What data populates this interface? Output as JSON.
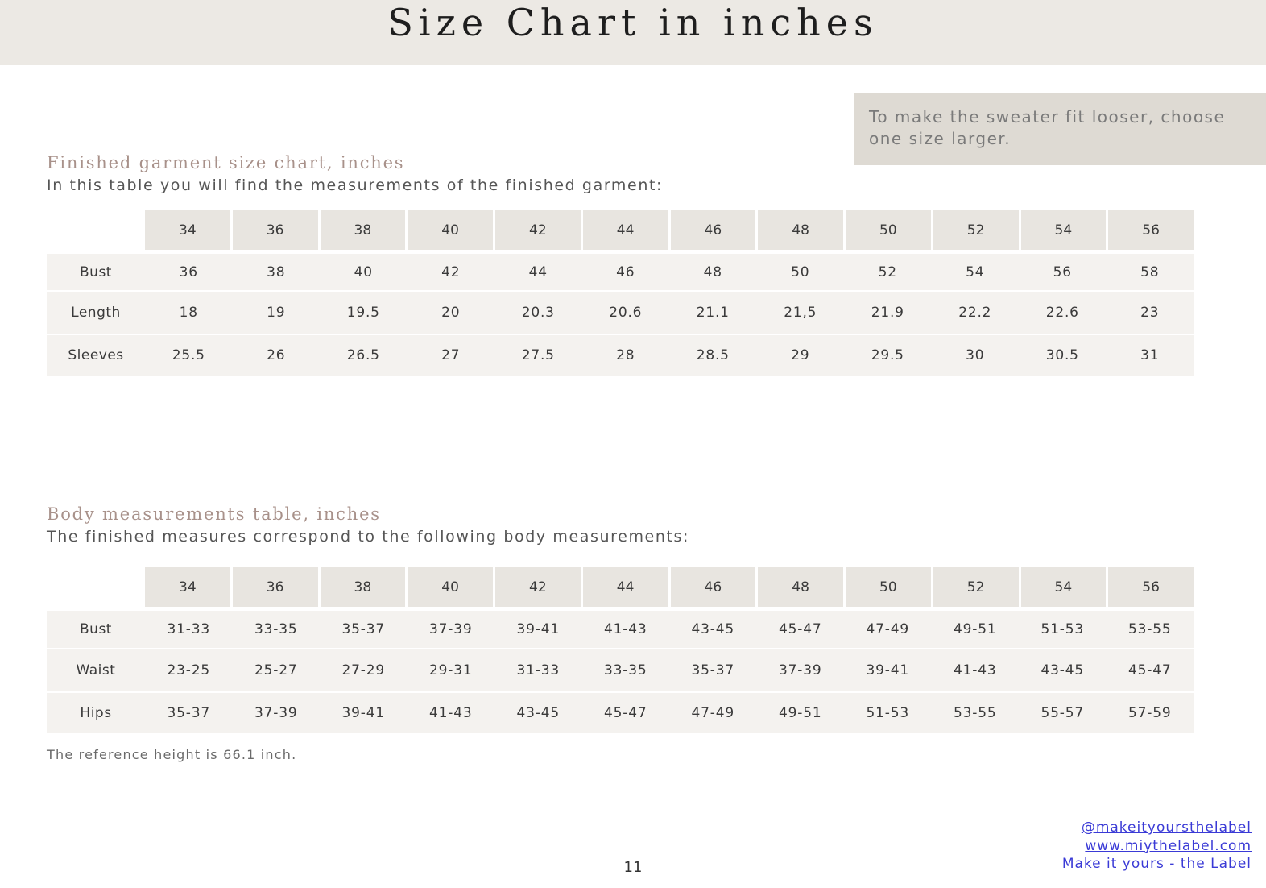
{
  "header": {
    "title": "Size Chart in inches"
  },
  "note": "To make the sweater fit looser, choose one size larger.",
  "finished_garment": {
    "title": "Finished garment size chart, inches",
    "subtitle": "In this table you will find the measurements of the finished garment:",
    "sizes": [
      "34",
      "36",
      "38",
      "40",
      "42",
      "44",
      "46",
      "48",
      "50",
      "52",
      "54",
      "56"
    ],
    "rows": [
      {
        "label": "Bust",
        "values": [
          "36",
          "38",
          "40",
          "42",
          "44",
          "46",
          "48",
          "50",
          "52",
          "54",
          "56",
          "58"
        ]
      },
      {
        "label": "Length",
        "values": [
          "18",
          "19",
          "19.5",
          "20",
          "20.3",
          "20.6",
          "21.1",
          "21,5",
          "21.9",
          "22.2",
          "22.6",
          "23"
        ]
      },
      {
        "label": "Sleeves",
        "values": [
          "25.5",
          "26",
          "26.5",
          "27",
          "27.5",
          "28",
          "28.5",
          "29",
          "29.5",
          "30",
          "30.5",
          "31"
        ]
      }
    ]
  },
  "body_measurements": {
    "title": "Body measurements table, inches",
    "subtitle": "The finished measures correspond to the following body measurements:",
    "sizes": [
      "34",
      "36",
      "38",
      "40",
      "42",
      "44",
      "46",
      "48",
      "50",
      "52",
      "54",
      "56"
    ],
    "rows": [
      {
        "label": "Bust",
        "values": [
          "31-33",
          "33-35",
          "35-37",
          "37-39",
          "39-41",
          "41-43",
          "43-45",
          "45-47",
          "47-49",
          "49-51",
          "51-53",
          "53-55"
        ]
      },
      {
        "label": "Waist",
        "values": [
          "23-25",
          "25-27",
          "27-29",
          "29-31",
          "31-33",
          "33-35",
          "35-37",
          "37-39",
          "39-41",
          "41-43",
          "43-45",
          "45-47"
        ]
      },
      {
        "label": "Hips",
        "values": [
          "35-37",
          "37-39",
          "39-41",
          "41-43",
          "43-45",
          "45-47",
          "47-49",
          "49-51",
          "51-53",
          "53-55",
          "55-57",
          "57-59"
        ]
      }
    ]
  },
  "footnote": "The reference height is 66.1 inch.",
  "page_number": "11",
  "footer_links": [
    {
      "label": "@makeityoursthelabel"
    },
    {
      "label": "www.miythelabel.com"
    },
    {
      "label": "Make it yours - the Label"
    }
  ],
  "colors": {
    "banner": "#ece9e4",
    "note_box": "#dedad3",
    "section_title": "#a8918a",
    "header_cell": "#e8e5e0",
    "row_background": "#f4f2ef",
    "link": "#3a3ad6"
  }
}
